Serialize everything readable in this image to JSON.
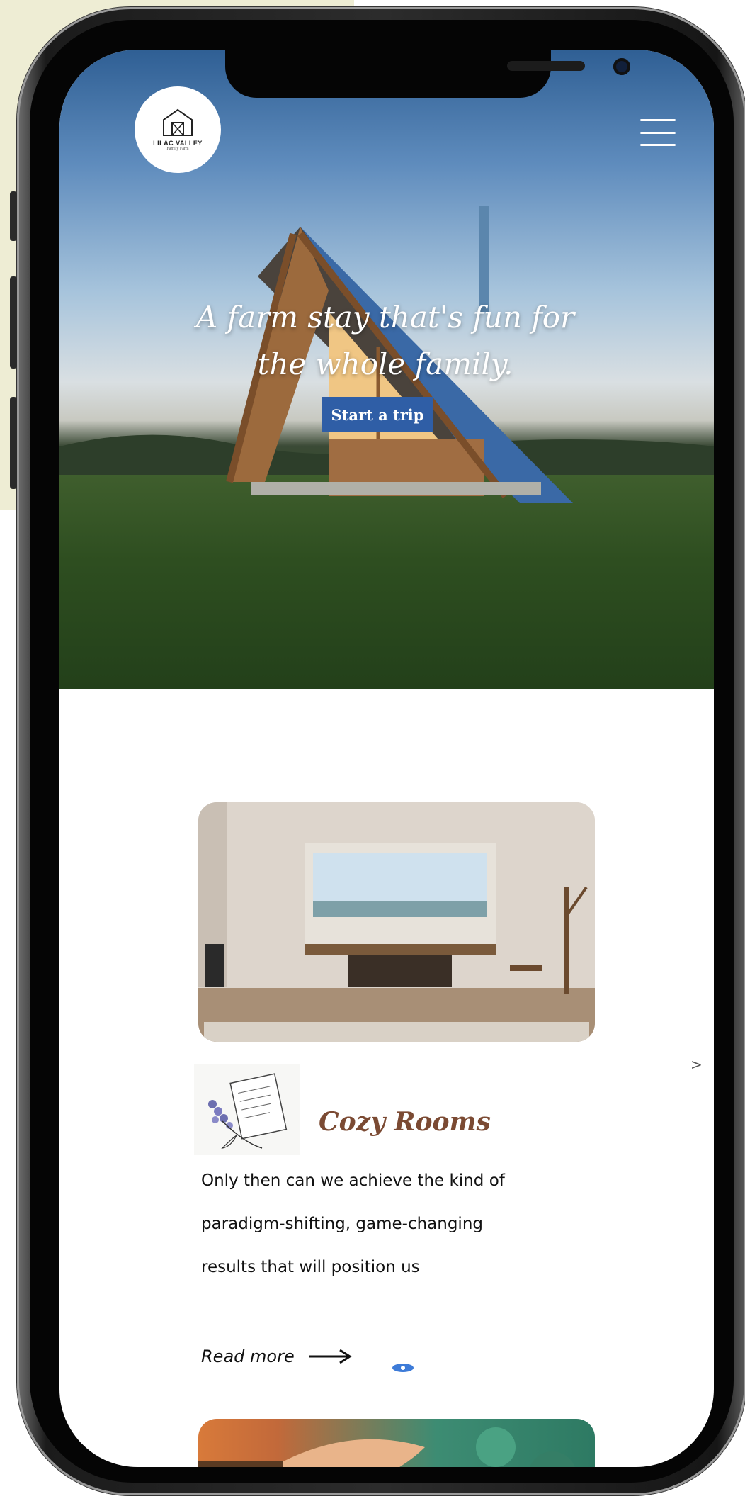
{
  "brand": {
    "logo_name": "LILAC VALLEY",
    "logo_sub": "Family Farm"
  },
  "hero": {
    "tagline_line1": "A farm stay that's fun for",
    "tagline_line2": "the whole family.",
    "cta_label": "Start a trip"
  },
  "carousel": {
    "next_label": ">",
    "card": {
      "title": "Cozy Rooms",
      "description": "Only then can we achieve the kind of paradigm-shifting, game-changing results that will position us",
      "read_more": "Read more"
    }
  },
  "colors": {
    "background_accent": "#eeedd4",
    "cta_blue": "#2f5ea6",
    "title_brown": "#7b4a33"
  }
}
